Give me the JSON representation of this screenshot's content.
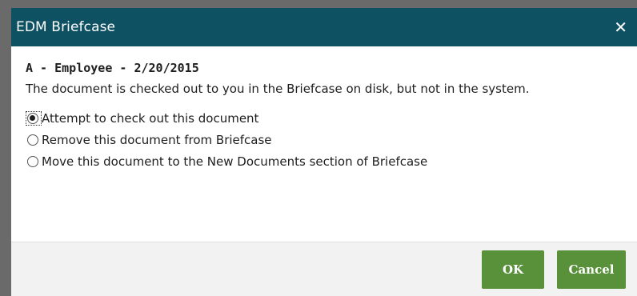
{
  "dialog": {
    "title": "EDM Briefcase",
    "close_glyph": "✕"
  },
  "content": {
    "heading": "A - Employee - 2/20/2015",
    "message": "The document is checked out to you in the Briefcase on disk, but not in the system."
  },
  "options": [
    {
      "label": "Attempt to check out this document",
      "selected": true
    },
    {
      "label": "Remove this document from Briefcase",
      "selected": false
    },
    {
      "label": "Move this document to the New Documents section of Briefcase",
      "selected": false
    }
  ],
  "buttons": {
    "ok_label": "OK",
    "cancel_label": "Cancel"
  },
  "colors": {
    "titlebar": "#0e5163",
    "button": "#58913a",
    "footer": "#f2f2f2"
  }
}
